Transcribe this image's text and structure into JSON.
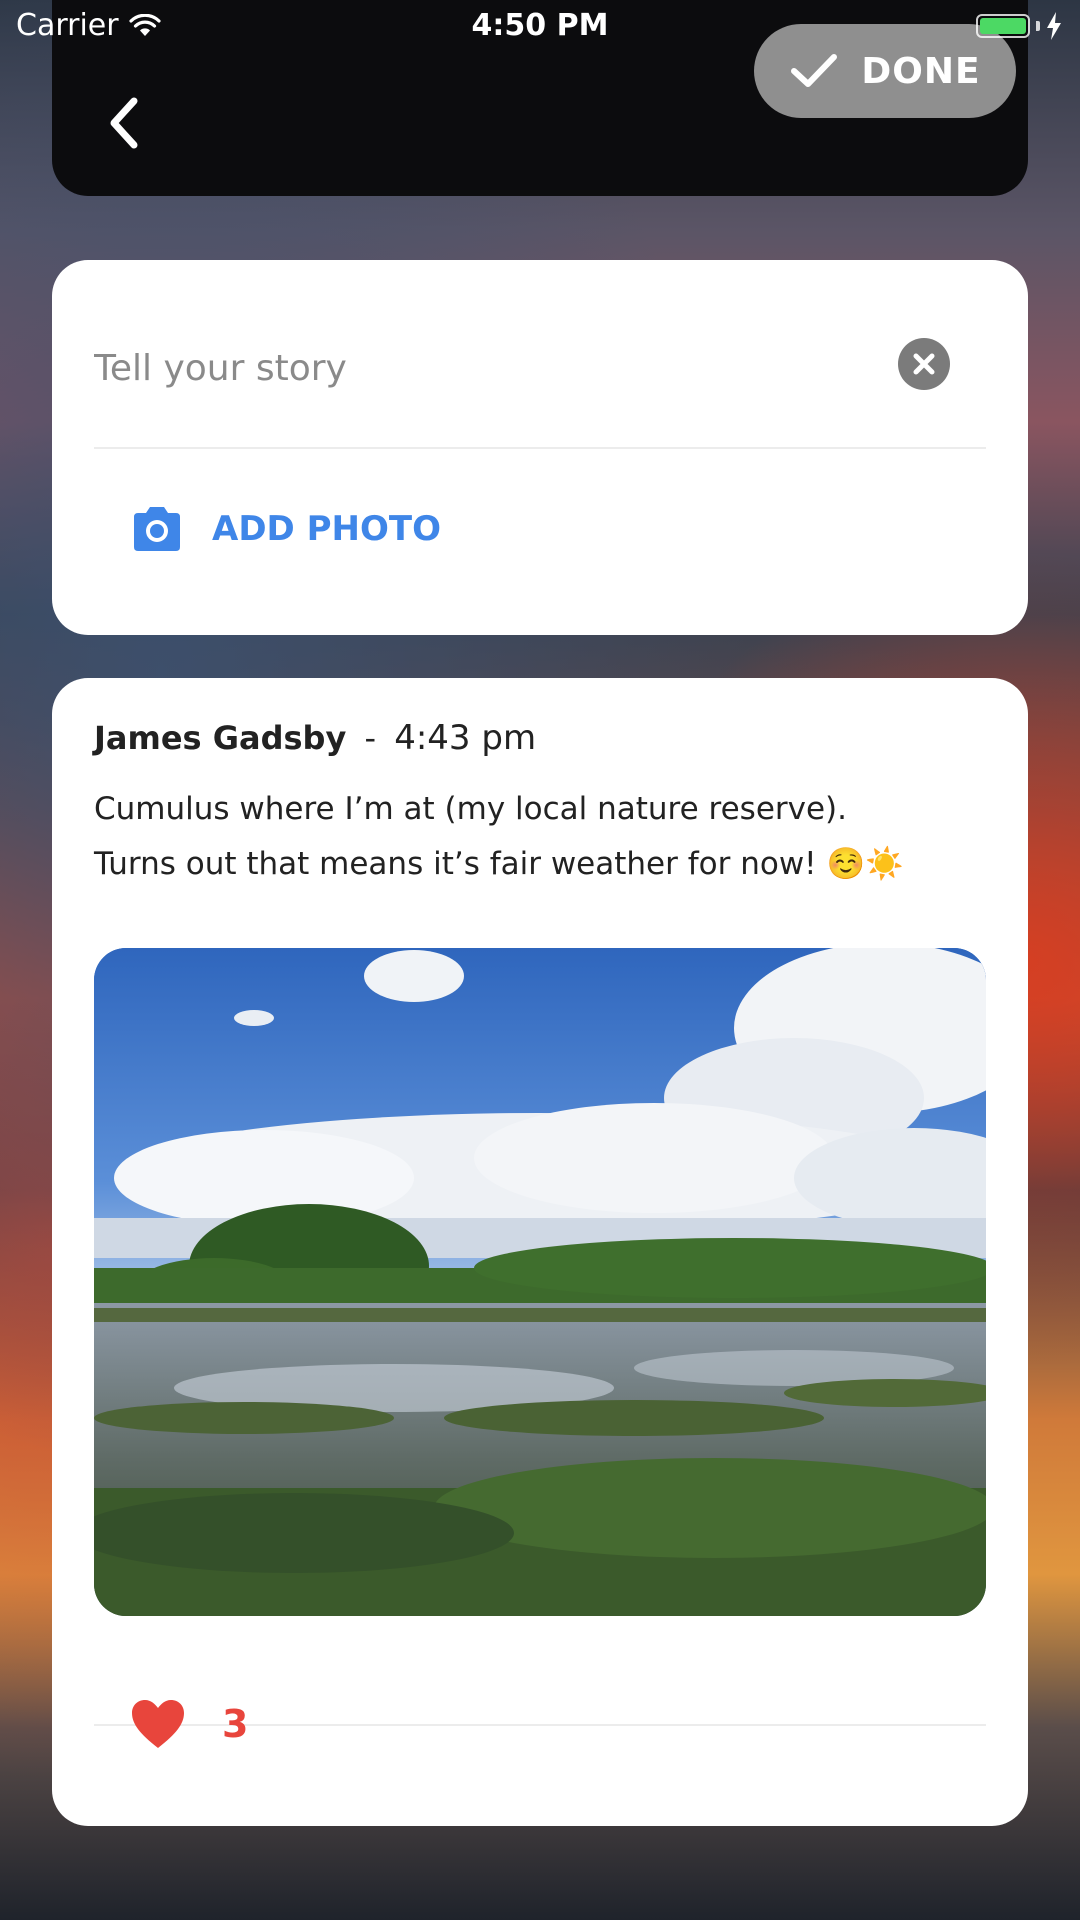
{
  "status_bar": {
    "carrier": "Carrier",
    "time": "4:50 PM",
    "wifi_icon": "wifi-icon",
    "battery_icon": "battery-icon",
    "charging_icon": "charging-bolt-icon"
  },
  "header": {
    "back_icon": "chevron-left-icon",
    "done_label": "DONE",
    "done_icon": "checkmark-icon"
  },
  "composer": {
    "placeholder": "Tell your story",
    "value": "",
    "clear_icon": "close-circle-icon",
    "add_photo_label": "ADD PHOTO",
    "add_photo_icon": "camera-icon"
  },
  "post": {
    "author": "James Gadsby",
    "separator": "-",
    "time": "4:43 pm",
    "text_line1": "Cumulus where I’m at (my local nature reserve).",
    "text_line2": "Turns out that means it’s fair weather for now! ☺️☀️",
    "like_icon": "heart-icon",
    "like_count": "3"
  },
  "colors": {
    "accent_blue": "#3f86e8",
    "like_red": "#e8453c",
    "done_button_bg": "#8f8f8f",
    "header_bg": "#0c0c0e",
    "battery_green": "#4cd964"
  }
}
